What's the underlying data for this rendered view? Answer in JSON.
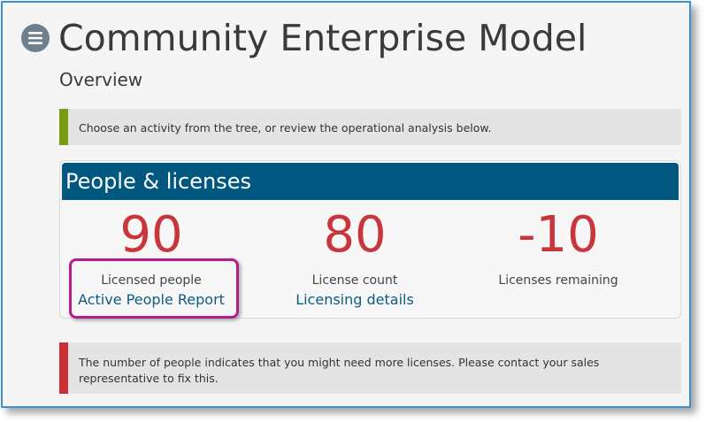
{
  "header": {
    "title": "Community Enterprise Model",
    "subtitle": "Overview",
    "menu_icon": "hamburger-menu-icon"
  },
  "info_notice": {
    "text": "Choose an activity from the tree, or review the operational analysis below.",
    "accent_color": "#7a9c0f"
  },
  "card": {
    "title": "People & licenses",
    "header_color": "#00577f",
    "metrics": [
      {
        "value": "90",
        "label": "Licensed people",
        "link": "Active People Report"
      },
      {
        "value": "80",
        "label": "License count",
        "link": "Licensing details"
      },
      {
        "value": "-10",
        "label": "Licenses remaining",
        "link": ""
      }
    ],
    "value_color": "#c9353b"
  },
  "warning_notice": {
    "text": "The number of people indicates that you might need more licenses. Please contact your sales representative to fix this.",
    "accent_color": "#cc2f36"
  },
  "annotation": {
    "highlight_color": "#b31e8a"
  }
}
